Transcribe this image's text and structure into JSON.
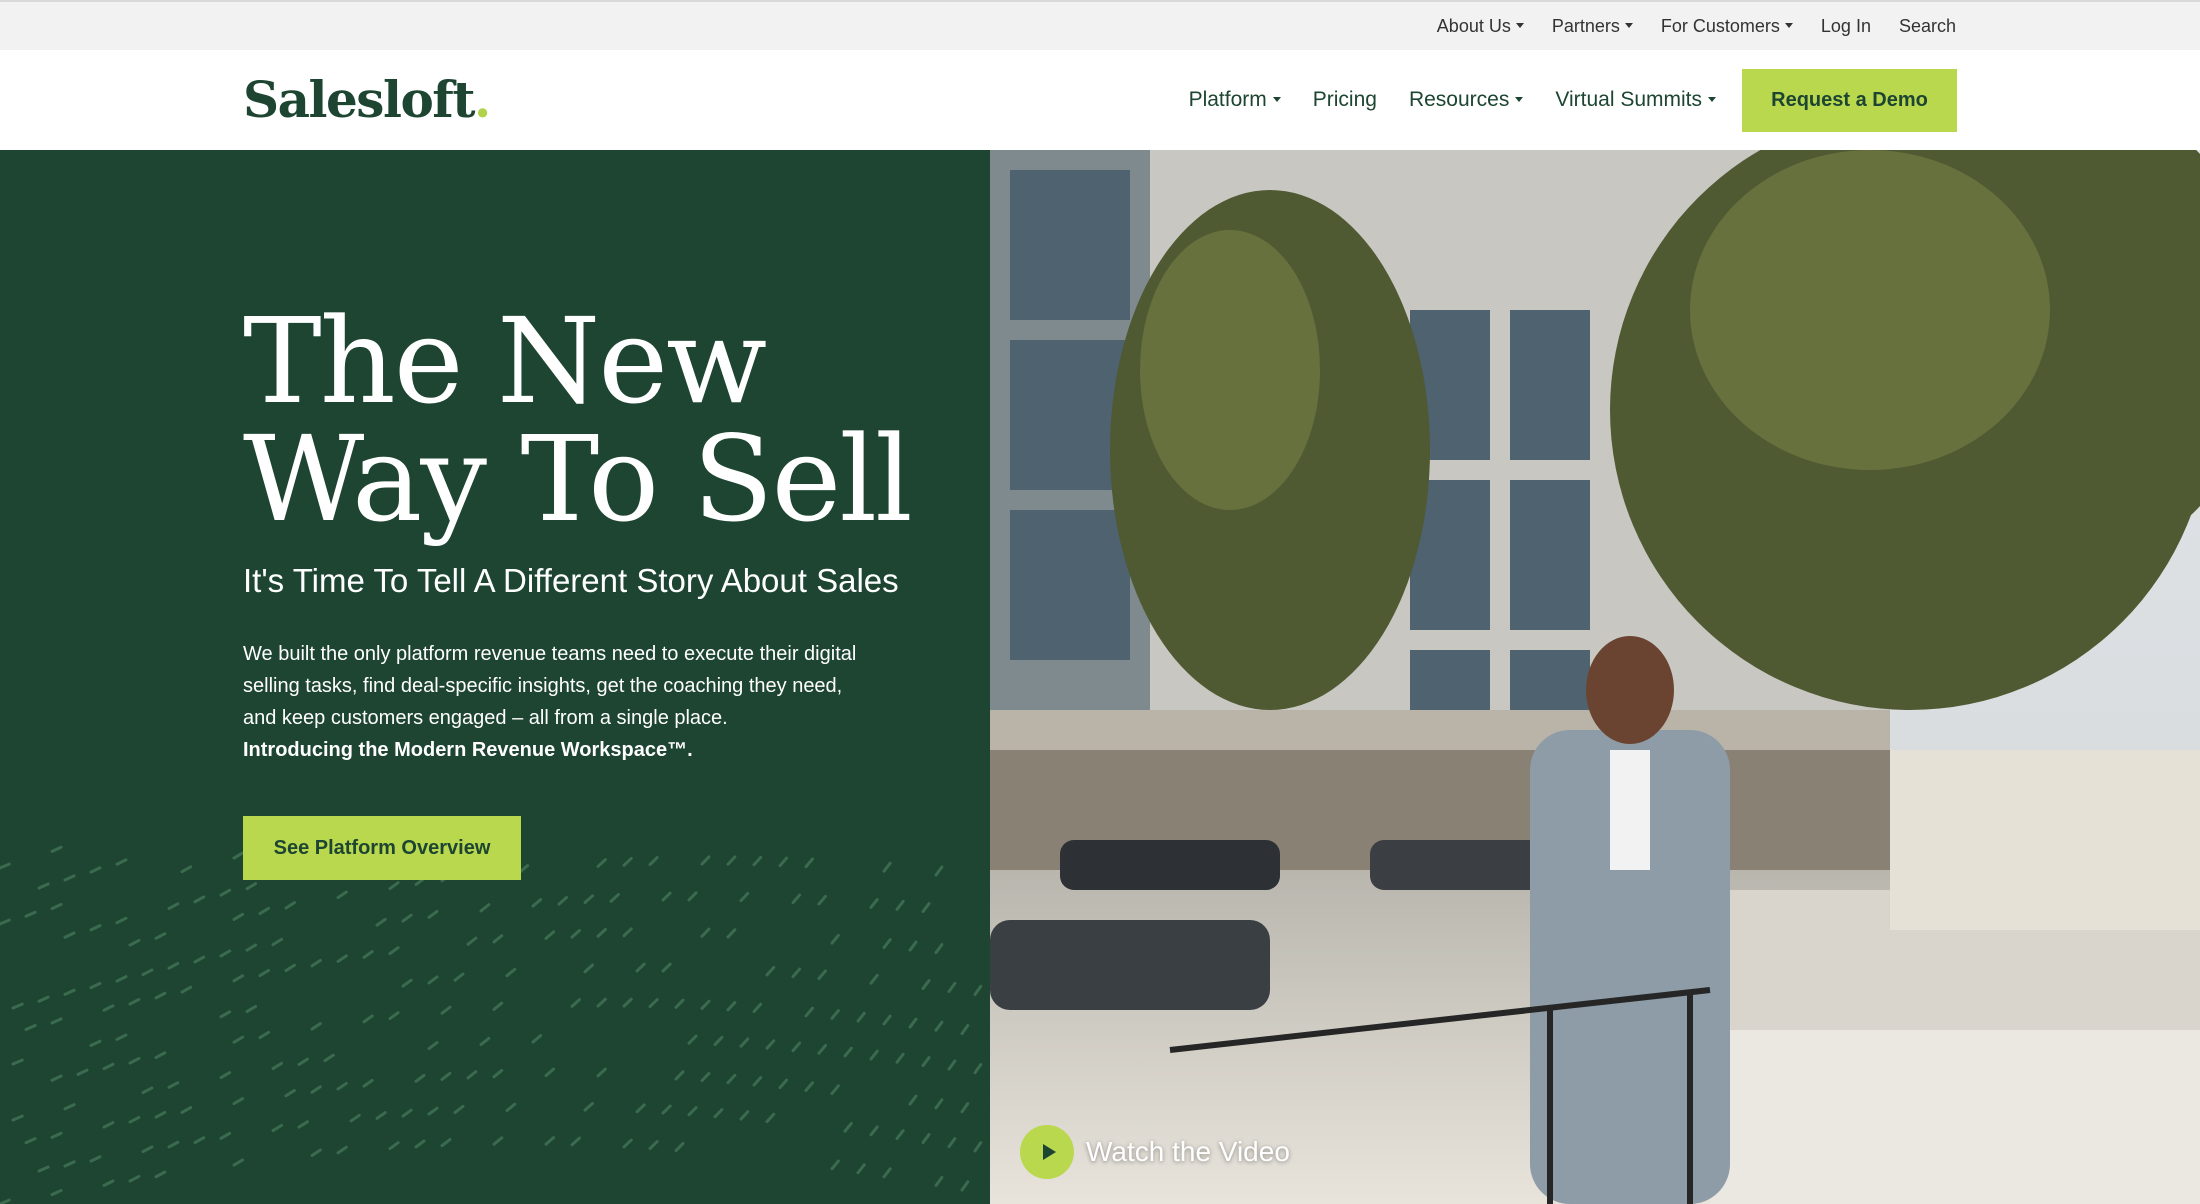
{
  "utility_nav": {
    "items": [
      {
        "label": "About Us",
        "dropdown": true
      },
      {
        "label": "Partners",
        "dropdown": true
      },
      {
        "label": "For Customers",
        "dropdown": true
      },
      {
        "label": "Log In",
        "dropdown": false
      },
      {
        "label": "Search",
        "dropdown": false
      }
    ]
  },
  "header": {
    "logo_text": "Salesloft",
    "logo_dot": ".",
    "nav": [
      {
        "label": "Platform",
        "dropdown": true
      },
      {
        "label": "Pricing",
        "dropdown": false
      },
      {
        "label": "Resources",
        "dropdown": true
      },
      {
        "label": "Virtual Summits",
        "dropdown": true
      }
    ],
    "cta_label": "Request a Demo"
  },
  "hero": {
    "title_line1": "The New",
    "title_line2": "Way To Sell",
    "subtitle": "It's Time To Tell A Different Story About Sales",
    "body": "We built the only platform revenue teams need to execute their digital selling tasks, find deal-specific insights, get the coaching they need, and keep customers engaged – all from a single place.",
    "body_strong": "Introducing the Modern Revenue Workspace™.",
    "cta_label": "See Platform Overview"
  },
  "video": {
    "watch_label": "Watch the Video"
  },
  "colors": {
    "brand_green": "#1d4531",
    "accent_lime": "#b9d84e",
    "utility_bg": "#f2f2f2"
  }
}
